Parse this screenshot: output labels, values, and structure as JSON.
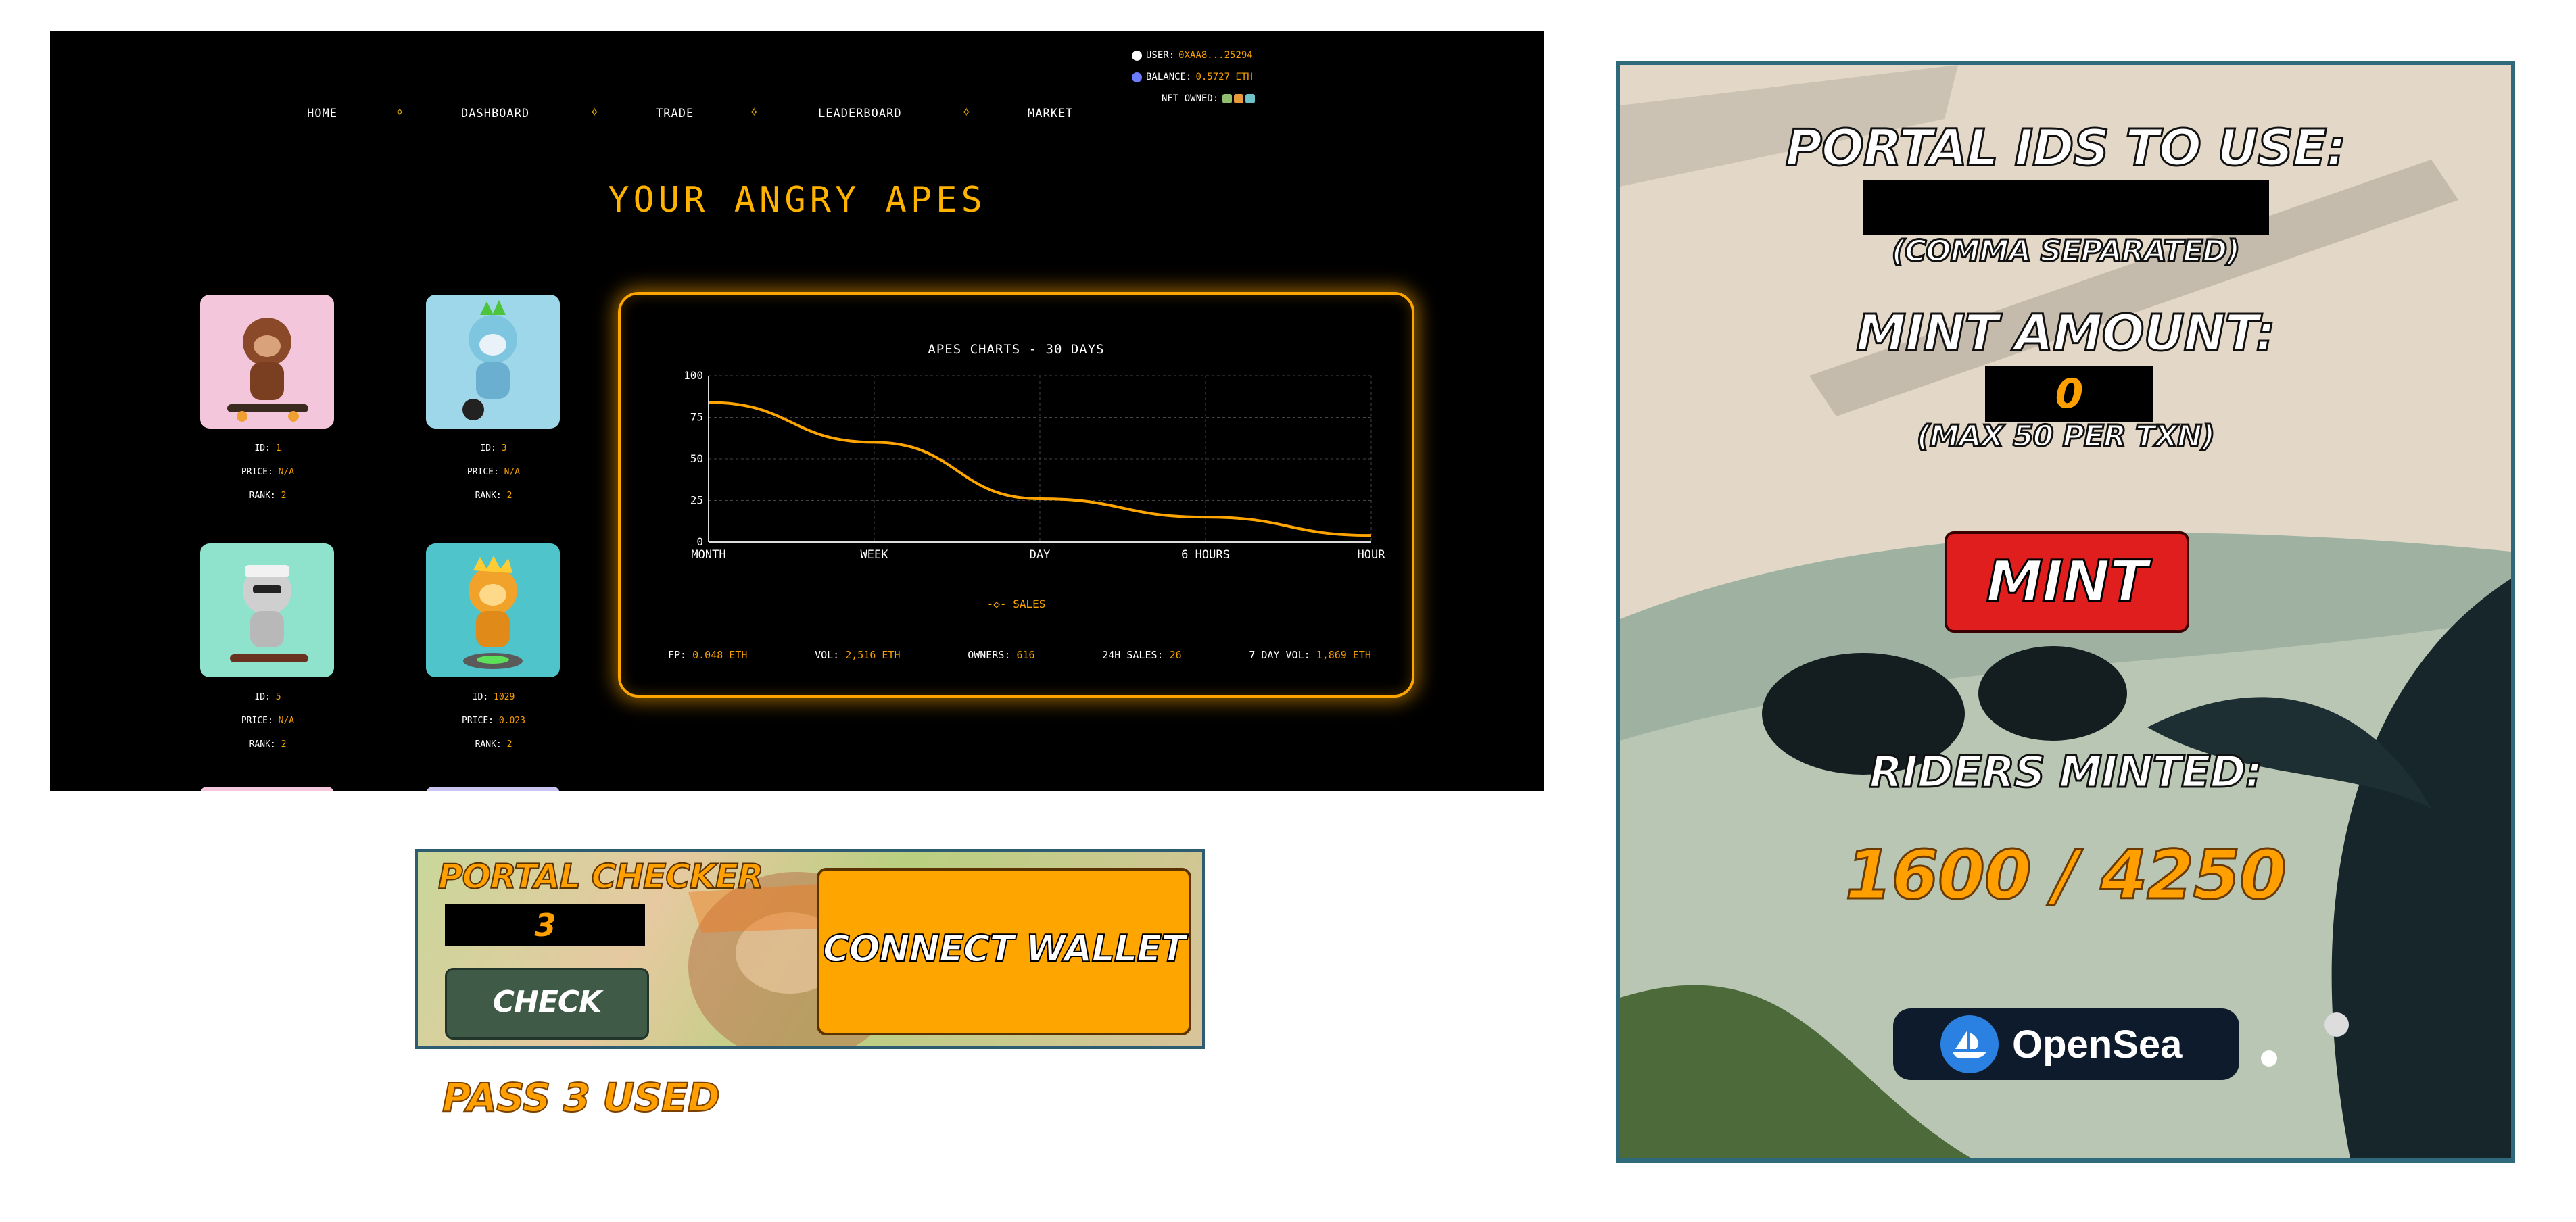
{
  "nav": {
    "items": [
      "HOME",
      "DASHBOARD",
      "TRADE",
      "LEADERBOARD",
      "MARKET"
    ],
    "separator_icon": "banana-icon"
  },
  "user": {
    "user_label": "USER:",
    "user_value": "0XAA8...25294",
    "balance_label": "BALANCE:",
    "balance_value": "0.5727 ETH",
    "nft_label": "NFT OWNED:"
  },
  "page_title": "YOUR ANGRY APES",
  "apes": [
    {
      "id_label": "ID:",
      "id": "1",
      "price_label": "PRICE:",
      "price": "N/A",
      "rank_label": "RANK:",
      "rank": "2",
      "bg": "#f4c6dc"
    },
    {
      "id_label": "ID:",
      "id": "3",
      "price_label": "PRICE:",
      "price": "N/A",
      "rank_label": "RANK:",
      "rank": "2",
      "bg": "#9fd7ea"
    },
    {
      "id_label": "ID:",
      "id": "5",
      "price_label": "PRICE:",
      "price": "N/A",
      "rank_label": "RANK:",
      "rank": "2",
      "bg": "#8fe3cc"
    },
    {
      "id_label": "ID:",
      "id": "1029",
      "price_label": "PRICE:",
      "price": "0.023",
      "rank_label": "RANK:",
      "rank": "2",
      "bg": "#4fc4cb"
    }
  ],
  "chart_panel": {
    "title": "APES CHARTS - 30 DAYS",
    "stats": [
      {
        "label": "FP:",
        "value": "0.048 ETH"
      },
      {
        "label": "VOL:",
        "value": "2,516 ETH"
      },
      {
        "label": "OWNERS:",
        "value": "616"
      },
      {
        "label": "24H SALES:",
        "value": "26"
      },
      {
        "label": "7 DAY VOL:",
        "value": "1,869 ETH"
      }
    ]
  },
  "chart_data": {
    "type": "line",
    "title": "APES CHARTS - 30 DAYS",
    "categories": [
      "MONTH",
      "WEEK",
      "DAY",
      "6 HOURS",
      "HOUR"
    ],
    "series": [
      {
        "name": "SALES",
        "values": [
          84,
          60,
          26,
          15,
          4
        ],
        "color": "#ffa500"
      }
    ],
    "ylim": [
      0,
      100
    ],
    "yticks": [
      0,
      25,
      50,
      75,
      100
    ],
    "grid": true,
    "legend": "bottom"
  },
  "checker": {
    "title": "PORTAL CHECKER",
    "input_value": "3",
    "check_label": "CHECK",
    "connect_label": "CONNECT WALLET",
    "result": "PASS 3 USED"
  },
  "mint": {
    "portal_ids_label": "PORTAL IDS TO USE:",
    "portal_ids_value": "",
    "comma_hint": "(COMMA SEPARATED)",
    "mint_amount_label": "MINT AMOUNT:",
    "mint_amount_value": "0",
    "max_hint": "(MAX 50 PER TXN)",
    "mint_button": "MINT",
    "riders_label": "RIDERS MINTED:",
    "riders_count": "1600 / 4250",
    "opensea_label": "OpenSea"
  },
  "colors": {
    "accent": "#ffa500",
    "mint_button": "#e01e1e",
    "panel_border": "#2e6a7b"
  }
}
